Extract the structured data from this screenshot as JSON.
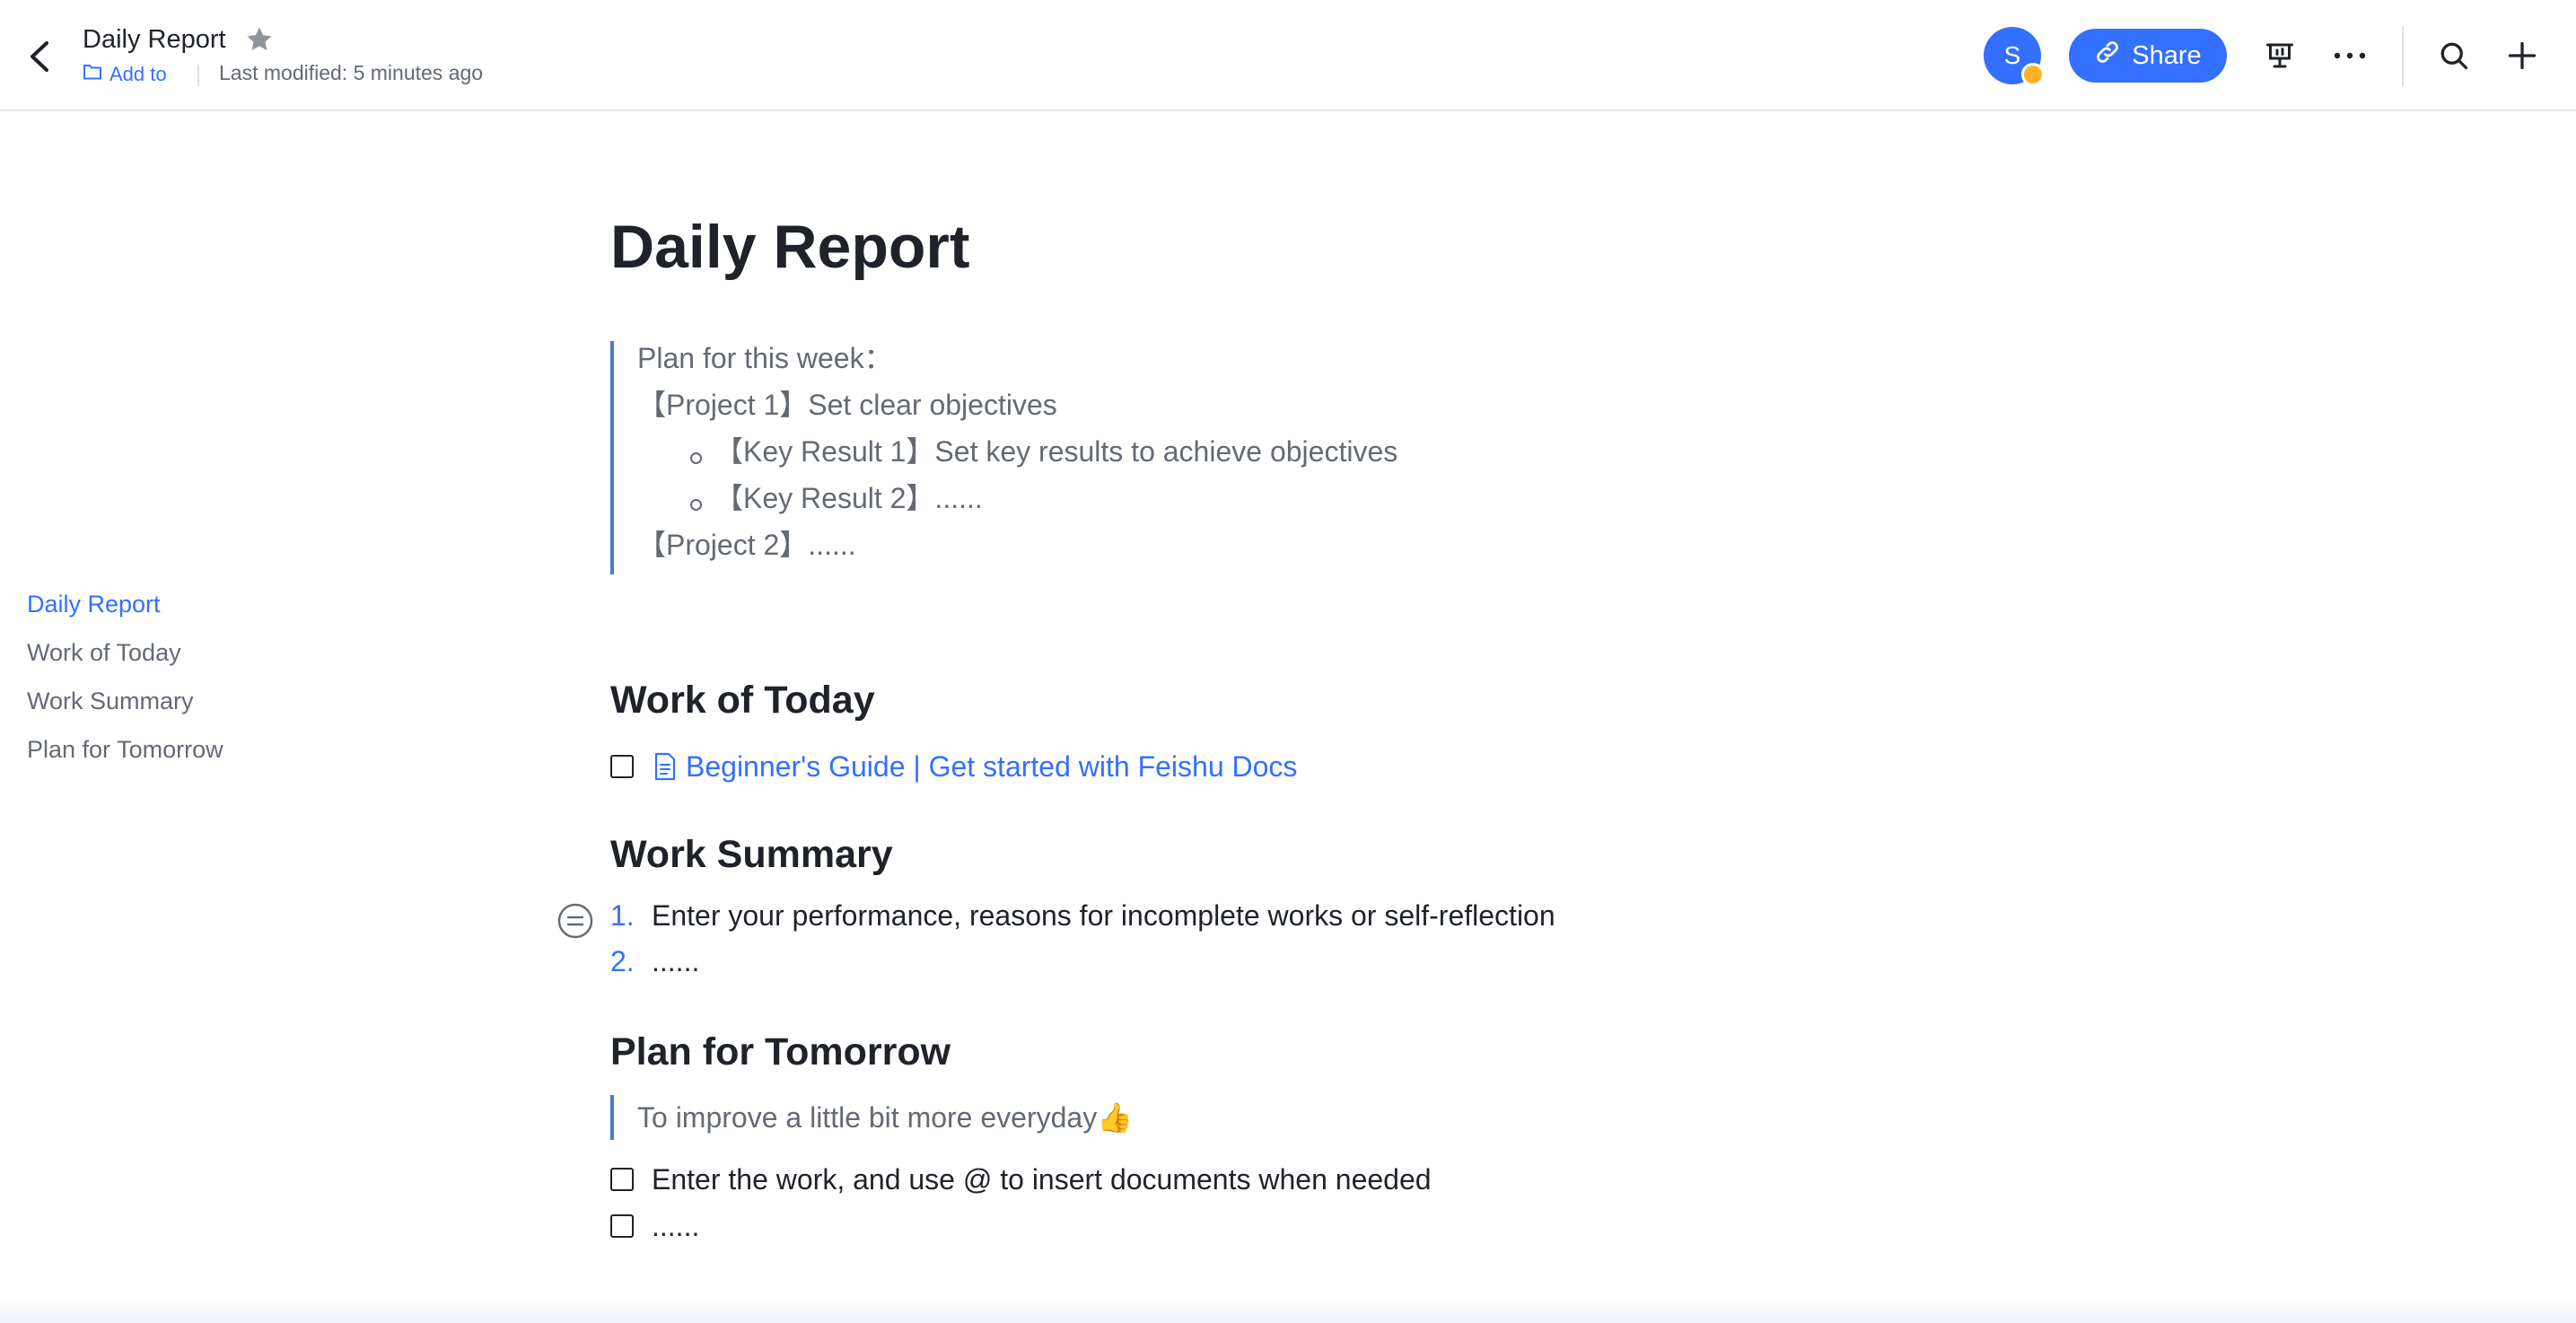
{
  "header": {
    "title": "Daily Report",
    "add_to": "Add to",
    "last_modified": "Last modified: 5 minutes ago",
    "avatar_initial": "S",
    "share_label": "Share"
  },
  "outline": {
    "items": [
      {
        "label": "Daily Report",
        "active": true
      },
      {
        "label": "Work of Today",
        "active": false
      },
      {
        "label": "Work Summary",
        "active": false
      },
      {
        "label": "Plan for Tomorrow",
        "active": false
      }
    ]
  },
  "doc": {
    "title": "Daily Report",
    "plan_quote": {
      "line1": "Plan for this week：",
      "line2": "【Project 1】Set clear objectives",
      "kr1": "【Key Result 1】Set key results to achieve objectives",
      "kr2": "【Key Result 2】......",
      "line3": "【Project 2】......"
    },
    "work_today": {
      "heading": "Work of Today",
      "task_link": "Beginner's Guide | Get started with Feishu Docs"
    },
    "work_summary": {
      "heading": "Work Summary",
      "items": [
        {
          "num": "1.",
          "text": "Enter your performance, reasons for incomplete works or self-reflection"
        },
        {
          "num": "2.",
          "text": "......"
        }
      ]
    },
    "plan_tomorrow": {
      "heading": "Plan for Tomorrow",
      "quote": "To improve a little bit more everyday👍",
      "tasks": [
        "Enter the work, and use @ to insert documents when needed",
        "......"
      ]
    }
  },
  "colors": {
    "accent": "#3370ff",
    "quote_bar": "#4a7bd0",
    "text": "#1f2329",
    "muted": "#646a73",
    "status_dot": "#ffb128"
  }
}
